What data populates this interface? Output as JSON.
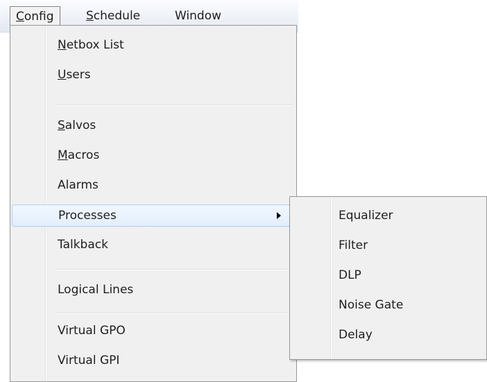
{
  "menubar": {
    "items": [
      {
        "mnemonic": "C",
        "rest": "onfig"
      },
      {
        "mnemonic": "S",
        "rest": "chedule"
      },
      {
        "label": "Window"
      }
    ]
  },
  "dropdown": {
    "items": [
      {
        "mnemonic": "N",
        "rest": "etbox List"
      },
      {
        "mnemonic": "U",
        "rest": "sers"
      },
      {
        "mnemonic": "S",
        "rest": "alvos"
      },
      {
        "mnemonic": "M",
        "rest": "acros"
      },
      {
        "label": "Alarms"
      },
      {
        "label": "Processes"
      },
      {
        "label": "Talkback"
      },
      {
        "label": "Logical Lines"
      },
      {
        "label": "Virtual GPO"
      },
      {
        "label": "Virtual GPI"
      }
    ]
  },
  "submenu": {
    "items": [
      {
        "label": "Equalizer"
      },
      {
        "label": "Filter"
      },
      {
        "label": "DLP"
      },
      {
        "label": "Noise Gate"
      },
      {
        "label": "Delay"
      }
    ]
  },
  "colors": {
    "menu_background": "#f0f0f0",
    "highlight_border": "#aecff7",
    "highlight_fill": "#e2eefc",
    "menubar_gradient_bottom": "#e3e8f1"
  }
}
